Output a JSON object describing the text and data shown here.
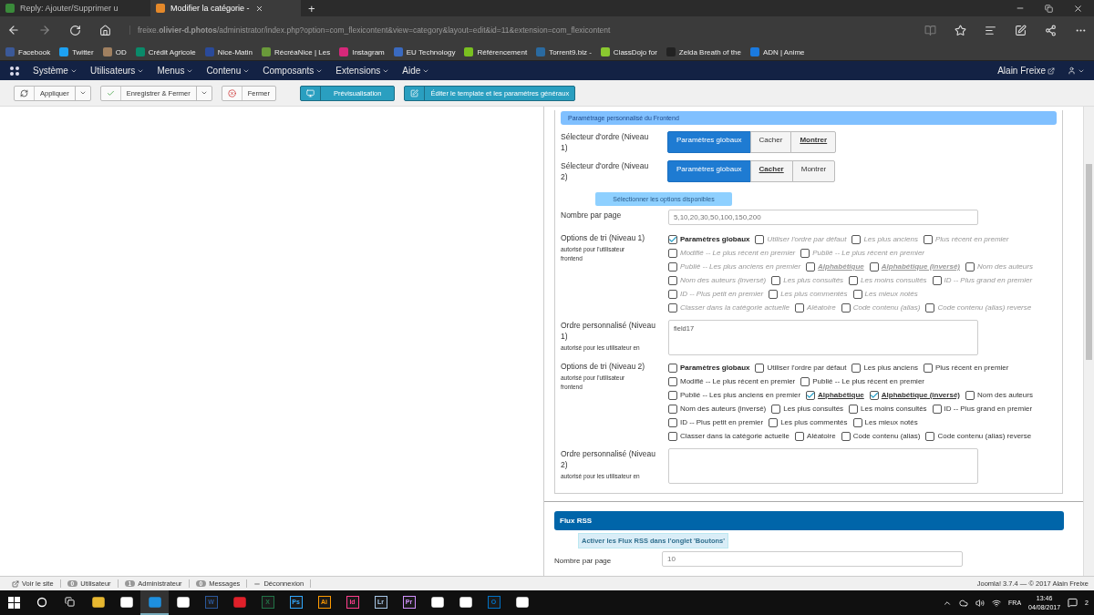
{
  "browser": {
    "tabs": [
      {
        "title": "Reply: Ajouter/Supprimer u",
        "selected": false
      },
      {
        "title": "Modifier la catégorie -",
        "selected": true
      }
    ],
    "new_tab": "+",
    "url": "freixe.**olivier-d.photos**/administrator/index.php?option=com_flexicontent&view=category&layout=edit&id=11&extension=com_flexicontent",
    "bookmarks": [
      {
        "label": "Facebook",
        "color": "#3b5998"
      },
      {
        "label": "Twitter",
        "color": "#1da1f2"
      },
      {
        "label": "OD",
        "color": "#a08060"
      },
      {
        "label": "Crédit Agricole",
        "color": "#0a8a6a"
      },
      {
        "label": "Nice-Matin",
        "color": "#2a4a9a"
      },
      {
        "label": "RécréaNice | Les",
        "color": "#6a9a3a"
      },
      {
        "label": "Instagram",
        "color": "#d6287a"
      },
      {
        "label": "EU Technology",
        "color": "#3a6ac0"
      },
      {
        "label": "Référencement",
        "color": "#7ac020"
      },
      {
        "label": "Torrent9.biz -",
        "color": "#2a6aa0"
      },
      {
        "label": "ClassDojo for",
        "color": "#8ac830"
      },
      {
        "label": "Zelda Breath of the",
        "color": "#222222"
      },
      {
        "label": "ADN | Anime",
        "color": "#1a7ae0"
      }
    ]
  },
  "admin_menu": {
    "items": [
      "Système",
      "Utilisateurs",
      "Menus",
      "Contenu",
      "Composants",
      "Extensions",
      "Aide"
    ],
    "user": "Alain Freixe"
  },
  "toolbar": [
    {
      "label": "Appliquer",
      "kind": "split"
    },
    {
      "label": "Enregistrer & Fermer",
      "kind": "split"
    },
    {
      "label": "Fermer",
      "kind": "plain"
    },
    {
      "label": "Prévisualisation",
      "kind": "primary"
    },
    {
      "label": "Éditer le template et les paramètres généraux",
      "kind": "primary"
    }
  ],
  "frontend_section": {
    "title": "Paramétrage personnalisé du Frontend",
    "rows": [
      {
        "kind": "segmented",
        "label": "Sélecteur d'ordre (Niveau 1)",
        "options": [
          {
            "label": "Paramètres globaux",
            "selected": true,
            "focused": false
          },
          {
            "label": "Cacher",
            "selected": false,
            "focused": false
          },
          {
            "label": "Montrer",
            "selected": false,
            "focused": true
          }
        ]
      },
      {
        "kind": "segmented",
        "label": "Sélecteur d'ordre (Niveau 2)",
        "options": [
          {
            "label": "Paramètres globaux",
            "selected": true,
            "focused": false
          },
          {
            "label": "Cacher",
            "selected": false,
            "focused": true
          },
          {
            "label": "Montrer",
            "selected": false,
            "focused": false
          }
        ]
      },
      {
        "kind": "note",
        "text": "Sélectionner les options disponibles"
      },
      {
        "kind": "text",
        "label": "Nombre par page",
        "value": "5,10,20,30,50,100,150,200"
      },
      {
        "kind": "checkboxes",
        "label": "Options de tri (Niveau 1)",
        "hint": "autorisé pour l'utilisateur frontend",
        "lines": [
          [
            {
              "label": "Paramètres globaux",
              "checked": true,
              "disabled": false,
              "kind": "bold"
            },
            {
              "label": "Utiliser l'ordre par défaut",
              "checked": false,
              "disabled": true,
              "kind": "plain"
            },
            {
              "label": "Les plus anciens",
              "checked": false,
              "disabled": true,
              "kind": "plain"
            },
            {
              "label": "Plus récent en premier",
              "checked": false,
              "disabled": true,
              "kind": "plain"
            }
          ],
          [
            {
              "label": "Modifié -- Le plus récent en premier",
              "checked": false,
              "disabled": true,
              "kind": "plain"
            },
            {
              "label": "Publié -- Le plus récent en premier",
              "checked": false,
              "disabled": true,
              "kind": "plain"
            }
          ],
          [
            {
              "label": "Publié -- Les plus anciens en premier",
              "checked": false,
              "disabled": true,
              "kind": "plain"
            },
            {
              "label": "Alphabétique",
              "checked": false,
              "disabled": true,
              "kind": "underline"
            },
            {
              "label": "Alphabétique (inversé)",
              "checked": false,
              "disabled": true,
              "kind": "underline"
            },
            {
              "label": "Nom des auteurs",
              "checked": false,
              "disabled": true,
              "kind": "plain"
            }
          ],
          [
            {
              "label": "Nom des auteurs (inversé)",
              "checked": false,
              "disabled": true,
              "kind": "plain"
            },
            {
              "label": "Les plus consultés",
              "checked": false,
              "disabled": true,
              "kind": "plain"
            },
            {
              "label": "Les moins consultés",
              "checked": false,
              "disabled": true,
              "kind": "plain"
            },
            {
              "label": "ID -- Plus grand en premier",
              "checked": false,
              "disabled": true,
              "kind": "plain"
            }
          ],
          [
            {
              "label": "ID -- Plus petit en premier",
              "checked": false,
              "disabled": true,
              "kind": "plain"
            },
            {
              "label": "Les plus commentés",
              "checked": false,
              "disabled": true,
              "kind": "plain"
            },
            {
              "label": "Les mieux notés",
              "checked": false,
              "disabled": true,
              "kind": "plain"
            }
          ],
          [
            {
              "label": "Classer dans la catégorie actuelle",
              "checked": false,
              "disabled": true,
              "kind": "plain"
            },
            {
              "label": "Aléatoire",
              "checked": false,
              "disabled": true,
              "kind": "plain"
            },
            {
              "label": "Code contenu (alias)",
              "checked": false,
              "disabled": true,
              "kind": "plain"
            },
            {
              "label": "Code contenu (alias) reverse",
              "checked": false,
              "disabled": true,
              "kind": "plain"
            }
          ]
        ]
      },
      {
        "kind": "textarea",
        "label": "Ordre personnalisé (Niveau 1)",
        "hint": "autorisé pour les utilisateur en",
        "value": "field17"
      },
      {
        "kind": "checkboxes",
        "label": "Options de tri (Niveau 2)",
        "hint": "autorisé pour l'utilisateur frontend",
        "lines": [
          [
            {
              "label": "Paramètres globaux",
              "checked": false,
              "disabled": false,
              "kind": "bold"
            },
            {
              "label": "Utiliser l'ordre par défaut",
              "checked": false,
              "disabled": false,
              "kind": "plain"
            },
            {
              "label": "Les plus anciens",
              "checked": false,
              "disabled": false,
              "kind": "plain"
            },
            {
              "label": "Plus récent en premier",
              "checked": false,
              "disabled": false,
              "kind": "plain"
            }
          ],
          [
            {
              "label": "Modifié -- Le plus récent en premier",
              "checked": false,
              "disabled": false,
              "kind": "plain"
            },
            {
              "label": "Publié -- Le plus récent en premier",
              "checked": false,
              "disabled": false,
              "kind": "plain"
            }
          ],
          [
            {
              "label": "Publié -- Les plus anciens en premier",
              "checked": false,
              "disabled": false,
              "kind": "plain"
            },
            {
              "label": "Alphabétique",
              "checked": true,
              "disabled": false,
              "kind": "underline"
            },
            {
              "label": "Alphabétique (inversé)",
              "checked": true,
              "disabled": false,
              "kind": "underline"
            },
            {
              "label": "Nom des auteurs",
              "checked": false,
              "disabled": false,
              "kind": "plain"
            }
          ],
          [
            {
              "label": "Nom des auteurs (inversé)",
              "checked": false,
              "disabled": false,
              "kind": "plain"
            },
            {
              "label": "Les plus consultés",
              "checked": false,
              "disabled": false,
              "kind": "plain"
            },
            {
              "label": "Les moins consultés",
              "checked": false,
              "disabled": false,
              "kind": "plain"
            },
            {
              "label": "ID -- Plus grand en premier",
              "checked": false,
              "disabled": false,
              "kind": "plain"
            }
          ],
          [
            {
              "label": "ID -- Plus petit en premier",
              "checked": false,
              "disabled": false,
              "kind": "plain"
            },
            {
              "label": "Les plus commentés",
              "checked": false,
              "disabled": false,
              "kind": "plain"
            },
            {
              "label": "Les mieux notés",
              "checked": false,
              "disabled": false,
              "kind": "plain"
            }
          ],
          [
            {
              "label": "Classer dans la catégorie actuelle",
              "checked": false,
              "disabled": false,
              "kind": "plain"
            },
            {
              "label": "Aléatoire",
              "checked": false,
              "disabled": false,
              "kind": "plain"
            },
            {
              "label": "Code contenu (alias)",
              "checked": false,
              "disabled": false,
              "kind": "plain"
            },
            {
              "label": "Code contenu (alias) reverse",
              "checked": false,
              "disabled": false,
              "kind": "plain"
            }
          ]
        ]
      },
      {
        "kind": "textarea",
        "label": "Ordre personnalisé (Niveau 2)",
        "hint": "autorisé pour les utilisateur en"
      }
    ]
  },
  "rss_section": {
    "title": "Flux RSS",
    "note": "Activer les Flux RSS dans l'onglet 'Boutons'",
    "field_label": "Nombre par page",
    "field_value": "10"
  },
  "status_bar": {
    "items": [
      {
        "kind": "link",
        "label": "Voir le site"
      },
      {
        "kind": "count",
        "count": "0",
        "label": "Utilisateur"
      },
      {
        "kind": "count",
        "count": "1",
        "label": "Administrateur"
      },
      {
        "kind": "count",
        "count": "0",
        "label": "Messages"
      },
      {
        "kind": "link",
        "label": "Déconnexion"
      }
    ],
    "footer": "Joomla! 3.7.4 — © 2017 Alain Freixe"
  },
  "taskbar": {
    "apps": [
      {
        "kind": "icon",
        "color": "#e8b830",
        "selected": false
      },
      {
        "kind": "icon",
        "color": "#ffffff",
        "selected": false
      },
      {
        "kind": "icon",
        "color": "#1e90e0",
        "selected": true
      },
      {
        "kind": "icon",
        "color": "#ffffff",
        "selected": false
      },
      {
        "kind": "tile",
        "label": "W",
        "color": "#2b579a",
        "selected": false
      },
      {
        "kind": "icon",
        "color": "#e0202a",
        "selected": false
      },
      {
        "kind": "tile",
        "label": "X",
        "color": "#217346",
        "selected": false
      },
      {
        "kind": "tile",
        "label": "Ps",
        "color": "#31a8ff",
        "selected": false
      },
      {
        "kind": "tile",
        "label": "Ai",
        "color": "#ff9a00",
        "selected": false
      },
      {
        "kind": "tile",
        "label": "Id",
        "color": "#ff3d8b",
        "selected": false
      },
      {
        "kind": "tile",
        "label": "Lr",
        "color": "#a8c8e8",
        "selected": false
      },
      {
        "kind": "tile",
        "label": "Pr",
        "color": "#d291ff",
        "selected": false
      },
      {
        "kind": "icon",
        "color": "#ffffff",
        "selected": false
      },
      {
        "kind": "icon",
        "color": "#ffffff",
        "selected": false
      },
      {
        "kind": "tile",
        "label": "O",
        "color": "#0072c6",
        "selected": false
      },
      {
        "kind": "icon",
        "color": "#ffffff",
        "selected": false
      }
    ],
    "language": "FRA",
    "time": "13:46",
    "date": "04/08/2017",
    "notifications": "2"
  }
}
